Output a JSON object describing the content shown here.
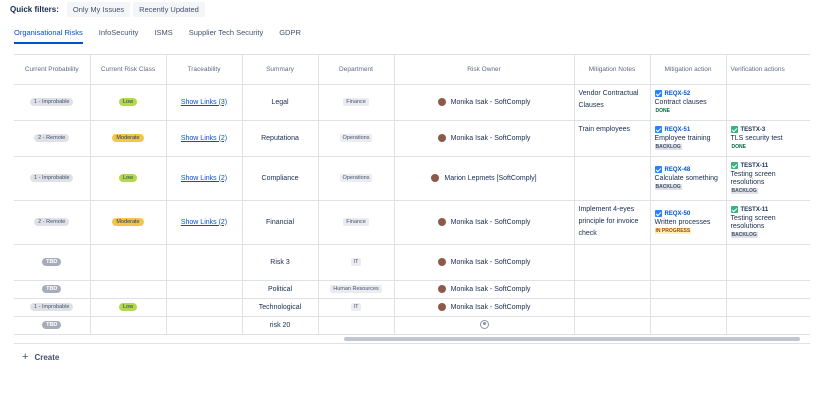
{
  "quick_filters": {
    "label": "Quick filters:",
    "buttons": [
      "Only My Issues",
      "Recently Updated"
    ]
  },
  "tabs": [
    "Organisational Risks",
    "InfoSecurity",
    "ISMS",
    "Supplier Tech Security",
    "GDPR"
  ],
  "columns": [
    "Current Probability",
    "Current Risk Class",
    "Traceability",
    "Summary",
    "Department",
    "Risk Owner",
    "Mitigation Notes",
    "Mitigation action",
    "Verification actions"
  ],
  "rows": [
    {
      "probability": "1 - Improbable",
      "risk_class": "Low",
      "traceability": "Show Links (3)",
      "summary": "Legal",
      "department": "Finance",
      "owner": "Monika Isak - SoftComply",
      "notes": "Vendor Contractual Clauses",
      "mitigation": {
        "key": "REQX-52",
        "title": "Contract clauses",
        "status": "DONE"
      },
      "verification": null
    },
    {
      "probability": "2 - Remote",
      "risk_class": "Moderate",
      "traceability": "Show Links (2)",
      "summary": "Reputationa",
      "department": "Operations",
      "owner": "Monika Isak - SoftComply",
      "notes": "Train employees",
      "mitigation": {
        "key": "REQX-51",
        "title": "Employee training",
        "status": "BACKLOG"
      },
      "verification": {
        "key": "TESTX-3",
        "title": "TLS security test",
        "status": "DONE"
      }
    },
    {
      "probability": "1 - Improbable",
      "risk_class": "Low",
      "traceability": "Show Links (2)",
      "summary": "Compliance",
      "department": "Operations",
      "owner": "Marion Lepmets [SoftComply]",
      "notes": "",
      "mitigation": {
        "key": "REQX-48",
        "title": "Calculate something",
        "status": "BACKLOG"
      },
      "verification": {
        "key": "TESTX-11",
        "title": "Testing screen resolutions",
        "status": "BACKLOG"
      }
    },
    {
      "probability": "2 - Remote",
      "risk_class": "Moderate",
      "traceability": "Show Links (2)",
      "summary": "Financial",
      "department": "Finance",
      "owner": "Monika Isak - SoftComply",
      "notes": "Implement 4-eyes principle for invoice check",
      "mitigation": {
        "key": "REQX-50",
        "title": "Written processes",
        "status": "IN PROGRESS"
      },
      "verification": {
        "key": "TESTX-11",
        "title": "Testing screen resolutions",
        "status": "BACKLOG"
      }
    },
    {
      "probability": "TBD",
      "risk_class": "",
      "traceability": "",
      "summary": "Risk 3",
      "department": "IT",
      "owner": "Monika Isak - SoftComply",
      "notes": "",
      "mitigation": null,
      "verification": null
    },
    {
      "probability": "TBD",
      "risk_class": "",
      "traceability": "",
      "summary": "Political",
      "department": "Human Resources",
      "owner": "Monika Isak - SoftComply",
      "notes": "",
      "mitigation": null,
      "verification": null
    },
    {
      "probability": "1 - Improbable",
      "risk_class": "Low",
      "traceability": "",
      "summary": "Technological",
      "department": "IT",
      "owner": "Monika Isak - SoftComply",
      "notes": "",
      "mitigation": null,
      "verification": null
    },
    {
      "probability": "TBD",
      "risk_class": "",
      "traceability": "",
      "summary": "risk 20",
      "department": "",
      "owner": "",
      "notes": "",
      "mitigation": null,
      "verification": null
    }
  ],
  "create_label": "Create",
  "colors": {
    "accent": "#0052cc",
    "low": "#b3d94a",
    "moderate": "#f5c44a",
    "tbd": "#a5adba"
  },
  "icons": {
    "mitigation_key": "checkbox-icon",
    "verification_key": "test-checkbox-icon",
    "create": "plus-icon",
    "owner": "avatar"
  }
}
